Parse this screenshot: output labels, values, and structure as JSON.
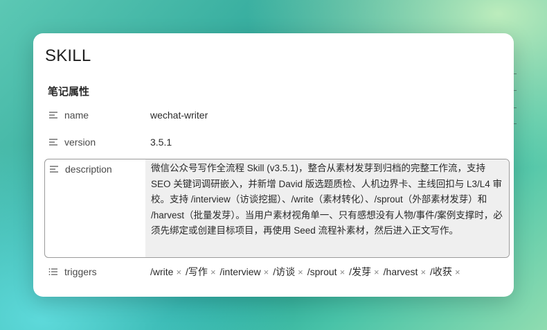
{
  "note": {
    "title": "SKILL"
  },
  "properties": {
    "heading": "笔记属性",
    "name": {
      "key": "name",
      "value": "wechat-writer",
      "icon": "text-lines-icon"
    },
    "version": {
      "key": "version",
      "value": "3.5.1",
      "icon": "text-lines-icon"
    },
    "description": {
      "key": "description",
      "value": "微信公众号写作全流程 Skill (v3.5.1)，整合从素材发芽到归档的完整工作流，支持 SEO 关键词调研嵌入，并新增 David 版选题质检、人机边界卡、主线回扣与 L3/L4 审校。支持 /interview（访谈挖掘）、/write（素材转化）、/sprout（外部素材发芽）和 /harvest（批量发芽）。当用户素材视角单一、只有感想没有人物/事件/案例支撑时，必须先绑定或创建目标项目，再使用 Seed 流程补素材，然后进入正文写作。",
      "icon": "text-lines-icon"
    },
    "triggers": {
      "key": "triggers",
      "icon": "list-icon",
      "remove_glyph": "×",
      "tags": [
        "/write",
        "/写作",
        "/interview",
        "/访谈",
        "/sprout",
        "/发芽",
        "/harvest",
        "/收获"
      ]
    }
  },
  "colors": {
    "card": "#ffffff",
    "description_bg": "#efefef",
    "description_border": "#9a9a9a",
    "text": "#2a2a2a",
    "muted": "#4a4a4a"
  }
}
